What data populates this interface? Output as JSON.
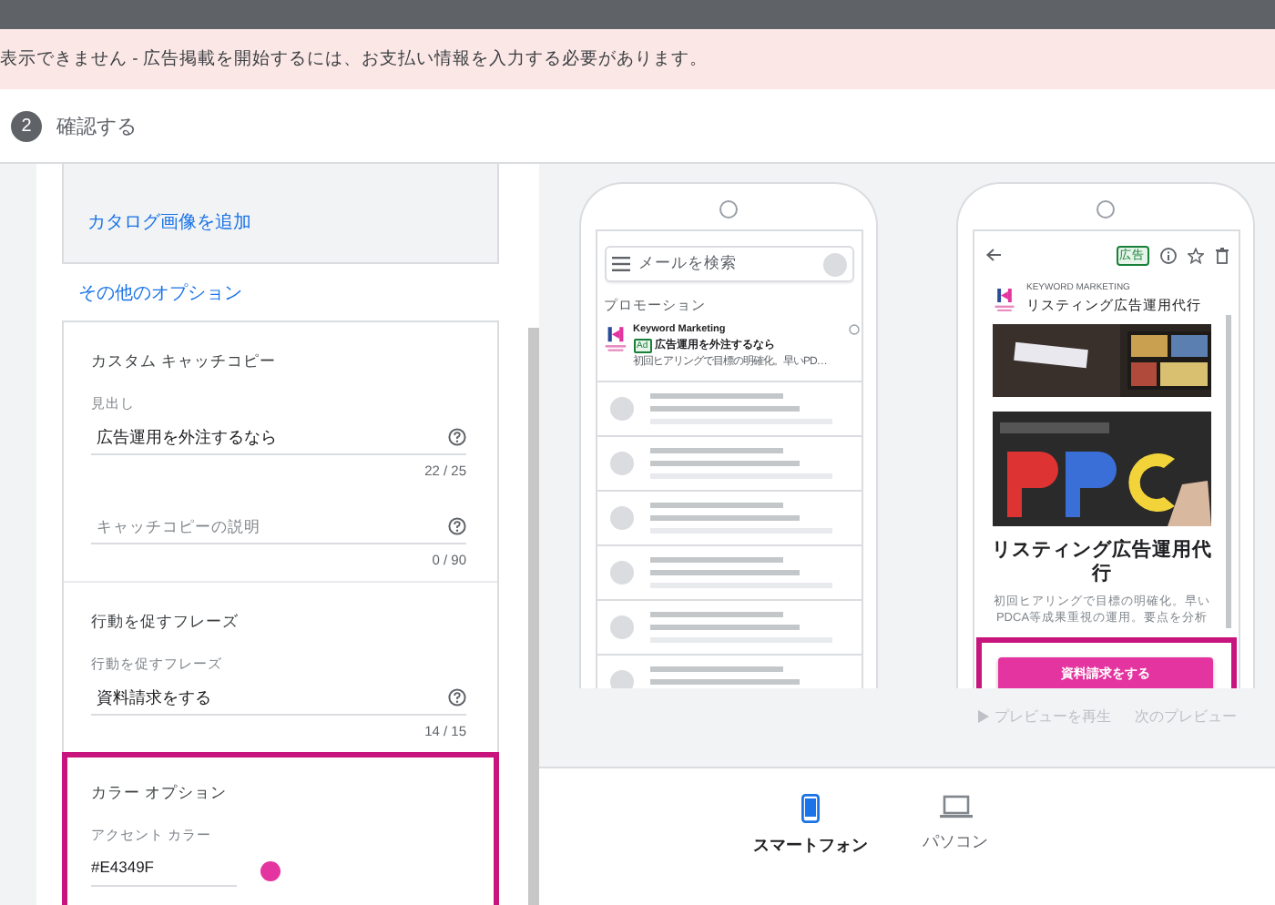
{
  "banner": {
    "message": "表示できません - 広告掲載を開始するには、お支払い情報を入力する必要があります。"
  },
  "step": {
    "number": "2",
    "label": "確認する"
  },
  "editor": {
    "catalog_link": "カタログ画像を追加",
    "more_options_link": "その他のオプション",
    "sections": [
      {
        "kind": "fields",
        "title": "カスタム キャッチコピー",
        "highlighted": false,
        "fields": [
          {
            "label": "見出し",
            "value": "広告運用を外注するなら",
            "counter": "22 / 25"
          },
          {
            "placeholder": "キャッチコピーの説明",
            "counter": "0 / 90"
          }
        ]
      },
      {
        "kind": "fields",
        "title": "行動を促すフレーズ",
        "highlighted": false,
        "fields": [
          {
            "label": "行動を促すフレーズ",
            "value": "資料請求をする",
            "counter": "14 / 15"
          }
        ]
      },
      {
        "kind": "color",
        "title": "カラー オプション",
        "highlighted": true,
        "label": "アクセント カラー",
        "value": "#E4349F",
        "color": "#e4349f"
      }
    ]
  },
  "preview": {
    "inbox": {
      "search_placeholder": "メールを検索",
      "category": "プロモーション",
      "ad": {
        "sender": "Keyword Marketing",
        "badge": "Ad",
        "subject": "広告運用を外注するなら",
        "snippet": "初回ヒアリングで目標の明確化。早いPD…"
      }
    },
    "message": {
      "badge": "広告",
      "sender": "KEYWORD MARKETING",
      "subject": "リスティング広告運用代行",
      "headline": "リスティング広告運用代行",
      "body": "初回ヒアリングで目標の明確化。早いPDCA等成果重視の運用。要点を分析",
      "cta": "資料請求をする",
      "cta_highlighted": true
    },
    "play_preview": "プレビューを再生",
    "next_preview": "次のプレビュー"
  },
  "devices": [
    {
      "label": "スマートフォン",
      "kind": "phone",
      "selected": true
    },
    {
      "label": "パソコン",
      "kind": "computer",
      "selected": false
    }
  ]
}
